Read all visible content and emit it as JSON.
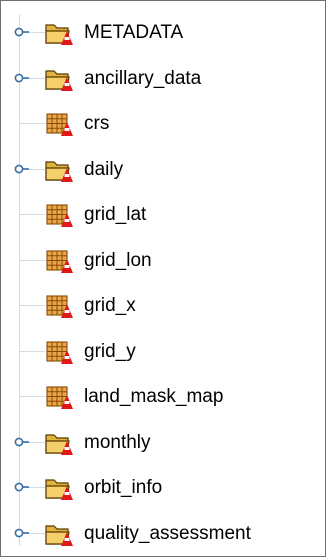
{
  "tree": {
    "items": [
      {
        "label": "METADATA",
        "kind": "group",
        "expandable": true,
        "icon": "folder-group-icon"
      },
      {
        "label": "ancillary_data",
        "kind": "group",
        "expandable": true,
        "icon": "folder-group-icon"
      },
      {
        "label": "crs",
        "kind": "dataset",
        "expandable": false,
        "icon": "dataset-grid-icon"
      },
      {
        "label": "daily",
        "kind": "group",
        "expandable": true,
        "icon": "folder-group-icon"
      },
      {
        "label": "grid_lat",
        "kind": "dataset",
        "expandable": false,
        "icon": "dataset-grid-icon"
      },
      {
        "label": "grid_lon",
        "kind": "dataset",
        "expandable": false,
        "icon": "dataset-grid-icon"
      },
      {
        "label": "grid_x",
        "kind": "dataset",
        "expandable": false,
        "icon": "dataset-grid-icon"
      },
      {
        "label": "grid_y",
        "kind": "dataset",
        "expandable": false,
        "icon": "dataset-grid-icon"
      },
      {
        "label": "land_mask_map",
        "kind": "dataset",
        "expandable": false,
        "icon": "dataset-grid-icon"
      },
      {
        "label": "monthly",
        "kind": "group",
        "expandable": true,
        "icon": "folder-group-icon"
      },
      {
        "label": "orbit_info",
        "kind": "group",
        "expandable": true,
        "icon": "folder-group-icon"
      },
      {
        "label": "quality_assessment",
        "kind": "group",
        "expandable": true,
        "icon": "folder-group-icon"
      }
    ]
  },
  "colors": {
    "connector_line": "#d0dce6",
    "toggle_key": "#3a6fa3",
    "folder_fill": "#e0b23e",
    "folder_outline": "#5a3a00",
    "badge_red": "#e01818",
    "grid_fill": "#e8a64a",
    "grid_lines": "#8a4a00"
  }
}
